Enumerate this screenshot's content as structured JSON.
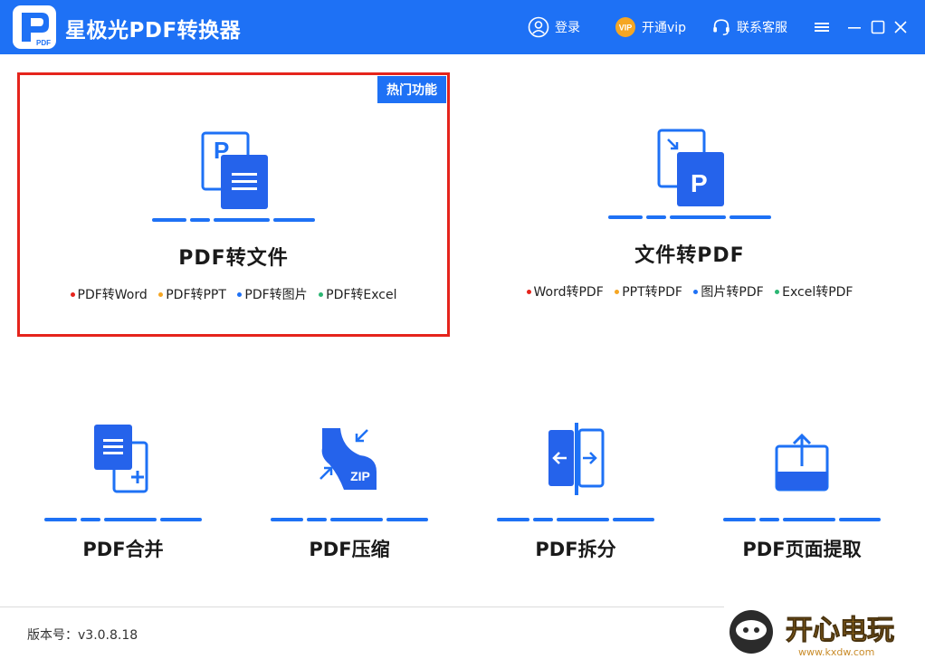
{
  "app": {
    "title": "星极光PDF转换器",
    "logo_label": "PDF"
  },
  "header": {
    "login": "登录",
    "vip_badge": "VIP",
    "vip": "开通vip",
    "support": "联系客服"
  },
  "cards": [
    {
      "title": "PDF转文件",
      "badge": "热门功能",
      "items": [
        {
          "label": "PDF转Word",
          "color": "#e5241c"
        },
        {
          "label": "PDF转PPT",
          "color": "#f5a623"
        },
        {
          "label": "PDF转图片",
          "color": "#1e71f5"
        },
        {
          "label": "PDF转Excel",
          "color": "#2bb673"
        }
      ]
    },
    {
      "title": "文件转PDF",
      "items": [
        {
          "label": "Word转PDF",
          "color": "#e5241c"
        },
        {
          "label": "PPT转PDF",
          "color": "#f5a623"
        },
        {
          "label": "图片转PDF",
          "color": "#1e71f5"
        },
        {
          "label": "Excel转PDF",
          "color": "#2bb673"
        }
      ]
    }
  ],
  "tools": [
    {
      "title": "PDF合并",
      "icon": "merge-icon"
    },
    {
      "title": "PDF压缩",
      "icon": "compress-icon",
      "icon_text": "ZIP"
    },
    {
      "title": "PDF拆分",
      "icon": "split-icon"
    },
    {
      "title": "PDF页面提取",
      "icon": "extract-icon"
    }
  ],
  "footer": {
    "version": "版本号：v3.0.8.18"
  },
  "watermark": {
    "text": "开心电玩",
    "url": "www.kxdw.com"
  },
  "colors": {
    "brand": "#1e71f5",
    "highlight": "#e5241c",
    "vip": "#f5a623"
  }
}
